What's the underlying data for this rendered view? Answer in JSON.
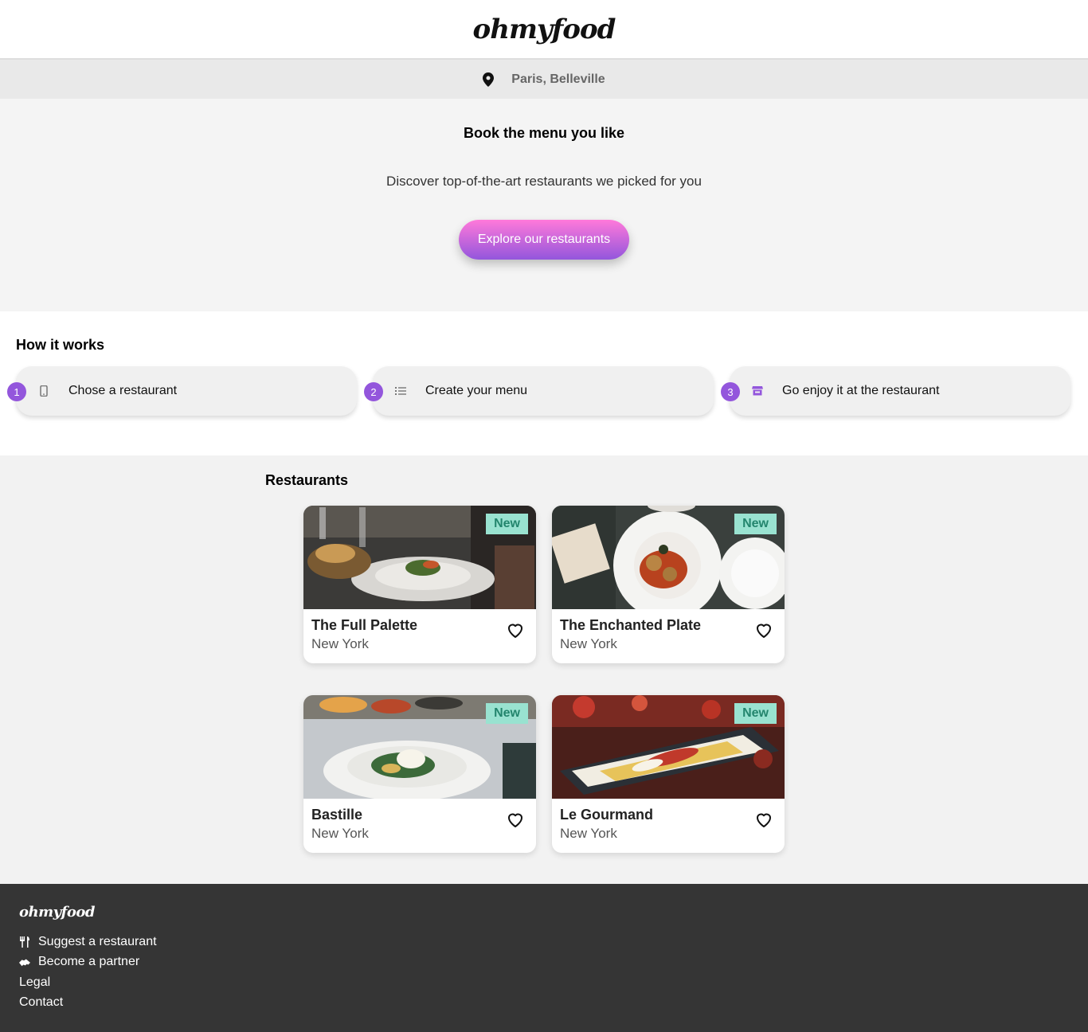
{
  "header": {
    "logo": "ohmyfood"
  },
  "location": {
    "text": "Paris, Belleville",
    "icon": "map-pin-icon"
  },
  "hero": {
    "title": "Book the menu you like",
    "subtitle": "Discover top-of-the-art restaurants we picked for you",
    "cta_label": "Explore our restaurants"
  },
  "how": {
    "title": "How it works",
    "steps": [
      {
        "number": "1",
        "label": "Chose a restaurant",
        "icon": "mobile-phone-icon"
      },
      {
        "number": "2",
        "label": "Create your menu",
        "icon": "list-icon"
      },
      {
        "number": "3",
        "label": "Go enjoy it at the restaurant",
        "icon": "store-icon"
      }
    ]
  },
  "restaurants": {
    "title": "Restaurants",
    "items": [
      {
        "name": "The Full Palette",
        "city": "New York",
        "badge": "New"
      },
      {
        "name": "The Enchanted Plate",
        "city": "New York",
        "badge": "New"
      },
      {
        "name": "Bastille",
        "city": "New York",
        "badge": "New"
      },
      {
        "name": "Le Gourmand",
        "city": "New York",
        "badge": "New"
      }
    ]
  },
  "footer": {
    "logo": "ohmyfood",
    "links": [
      {
        "label": "Suggest a restaurant",
        "icon": "utensils-icon"
      },
      {
        "label": "Become a partner",
        "icon": "handshake-icon"
      },
      {
        "label": "Legal"
      },
      {
        "label": "Contact"
      }
    ]
  },
  "colors": {
    "accent": "#9356dc",
    "accent_light": "#ff79da",
    "badge_bg": "#99e2d0",
    "badge_text": "#23856d",
    "footer_bg": "#353535"
  }
}
